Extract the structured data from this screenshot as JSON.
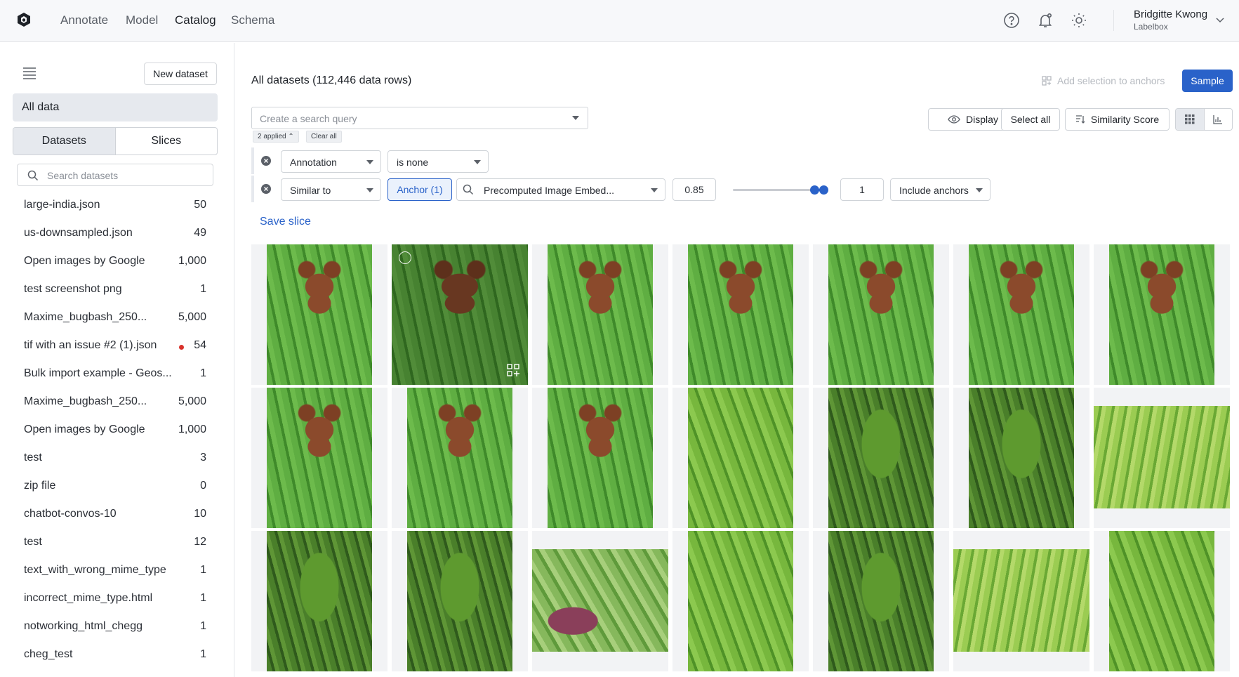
{
  "nav": {
    "links": [
      "Annotate",
      "Model",
      "Catalog",
      "Schema"
    ],
    "active": "Catalog",
    "user_name": "Bridgitte Kwong",
    "user_org": "Labelbox"
  },
  "sidebar": {
    "new_dataset": "New dataset",
    "all_data": "All data",
    "tabs": [
      "Datasets",
      "Slices"
    ],
    "search_placeholder": "Search datasets",
    "datasets": [
      {
        "name": "large-india.json",
        "count": "50"
      },
      {
        "name": "us-downsampled.json",
        "count": "49"
      },
      {
        "name": "Open images by Google",
        "count": "1,000"
      },
      {
        "name": "test screenshot png",
        "count": "1"
      },
      {
        "name": "Maxime_bugbash_250...",
        "count": "5,000"
      },
      {
        "name": "tif with an issue #2 (1).json",
        "count": "54",
        "alert": true
      },
      {
        "name": "Bulk import example - Geos...",
        "count": "1"
      },
      {
        "name": "Maxime_bugbash_250...",
        "count": "5,000"
      },
      {
        "name": "Open images by Google",
        "count": "1,000"
      },
      {
        "name": "test",
        "count": "3"
      },
      {
        "name": "zip file",
        "count": "0"
      },
      {
        "name": "chatbot-convos-10",
        "count": "10"
      },
      {
        "name": "test",
        "count": "12"
      },
      {
        "name": "text_with_wrong_mime_type",
        "count": "1"
      },
      {
        "name": "incorrect_mime_type.html",
        "count": "1"
      },
      {
        "name": "notworking_html_chegg",
        "count": "1"
      },
      {
        "name": "cheg_test",
        "count": "1"
      }
    ]
  },
  "main": {
    "title": "All datasets (112,446 data rows)",
    "add_selection": "Add selection to anchors",
    "sample": "Sample",
    "search_placeholder": "Create a search query",
    "applied": "2 applied",
    "clear_all": "Clear all",
    "display": "Display",
    "select_all": "Select all",
    "similarity_score": "Similarity Score",
    "filter1": {
      "field": "Annotation",
      "operator": "is none"
    },
    "filter2": {
      "field": "Similar to",
      "anchor": "Anchor (1)",
      "embedding": "Precomputed Image Embed...",
      "threshold": "0.85",
      "slider_low": 0.85,
      "slider_high": 1,
      "max": "1",
      "include": "Include anchors"
    },
    "save_slice": "Save slice"
  },
  "colors": {
    "accent": "#2a62c9",
    "alert": "#d9322b"
  },
  "grid_rows": [
    [
      "teddy",
      "teddy",
      "teddy",
      "teddy",
      "teddy",
      "teddy",
      "teddy"
    ],
    [
      "teddy",
      "teddy",
      "teddy",
      "bunch",
      "dark",
      "dark",
      "bunch2"
    ],
    [
      "dark",
      "dark",
      "leaf",
      "bunch",
      "dark",
      "bunch2",
      "bunch"
    ]
  ]
}
